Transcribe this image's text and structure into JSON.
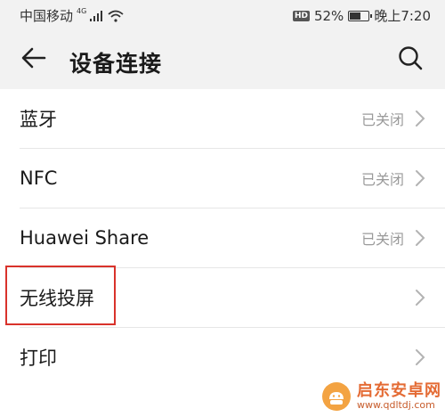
{
  "status_bar": {
    "carrier": "中国移动",
    "network_type": "4G",
    "hd_badge": "HD",
    "battery_percent": "52%",
    "battery_level": 0.52,
    "time": "晚上7:20"
  },
  "app_bar": {
    "title": "设备连接",
    "back_icon": "arrow-left-icon",
    "search_icon": "search-icon"
  },
  "items": [
    {
      "label": "蓝牙",
      "status": "已关闭"
    },
    {
      "label": "NFC",
      "status": "已关闭"
    },
    {
      "label": "Huawei Share",
      "status": "已关闭"
    },
    {
      "label": "无线投屏",
      "status": ""
    },
    {
      "label": "打印",
      "status": ""
    }
  ],
  "watermark": {
    "name": "启东安卓网",
    "url": "www.qdltdj.com"
  },
  "colors": {
    "header_bg": "#f2f2f2",
    "highlight": "#d9322b",
    "status_text": "#9a9a9a"
  }
}
